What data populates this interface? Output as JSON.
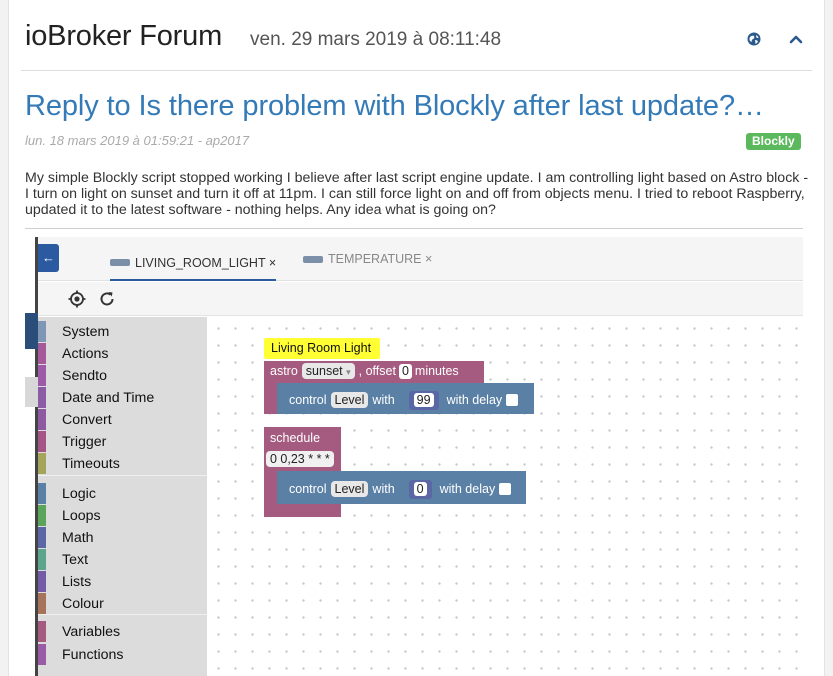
{
  "header": {
    "title": "ioBroker Forum",
    "date": "ven. 29 mars 2019 à 08:11:48"
  },
  "post": {
    "title": "Reply to Is there problem with Blockly after last update?…",
    "meta": "lun. 18 mars 2019 à 01:59:21 - ap2017",
    "tag": "Blockly",
    "body": "My simple Blockly script stopped working I believe after last script engine update. I am controlling light based on Astro block - I turn on light on sunset and turn it off at 11pm. I can still force light on and off from objects menu. I tried to reboot Raspberry, updated it to the latest software - nothing helps. Any idea what is going on?"
  },
  "screenshot": {
    "tabs": [
      {
        "label": "LIVING_ROOM_LIGHT ×",
        "active": true
      },
      {
        "label": "TEMPERATURE ×",
        "active": false
      }
    ],
    "categories": [
      {
        "label": "System",
        "color": "#7f97b5"
      },
      {
        "label": "Actions",
        "color": "#a5599a"
      },
      {
        "label": "Sendto",
        "color": "#9d5aa6"
      },
      {
        "label": "Date and Time",
        "color": "#8a5ca5"
      },
      {
        "label": "Convert",
        "color": "#8d5aa2"
      },
      {
        "label": "Trigger",
        "color": "#a45486"
      },
      {
        "label": "Timeouts",
        "color": "#a5a55a"
      },
      {
        "label": "Logic",
        "color": "#5b80a5"
      },
      {
        "label": "Loops",
        "color": "#5ba55b"
      },
      {
        "label": "Math",
        "color": "#5b67a5"
      },
      {
        "label": "Text",
        "color": "#5ba58c"
      },
      {
        "label": "Lists",
        "color": "#745ba5"
      },
      {
        "label": "Colour",
        "color": "#a5745b"
      },
      {
        "label": "Variables",
        "color": "#a55b80"
      },
      {
        "label": "Functions",
        "color": "#995ba5"
      }
    ],
    "blocks": {
      "comment": "Living Room Light",
      "astro": {
        "label": "astro",
        "event": "sunset",
        "offset_label": ", offset",
        "offset": "0",
        "unit": "minutes"
      },
      "control1": {
        "label": "control",
        "object": "Level",
        "with_label": "with",
        "value": "99",
        "delay_label": "with delay"
      },
      "schedule": {
        "label": "schedule",
        "cron": "0 0,23 * * *"
      },
      "control2": {
        "label": "control",
        "object": "Level",
        "with_label": "with",
        "value": "0",
        "delay_label": "with delay"
      }
    },
    "colors": {
      "trigger": "#a55b80",
      "action": "#5b80a5",
      "comment": "#ffff33"
    }
  }
}
